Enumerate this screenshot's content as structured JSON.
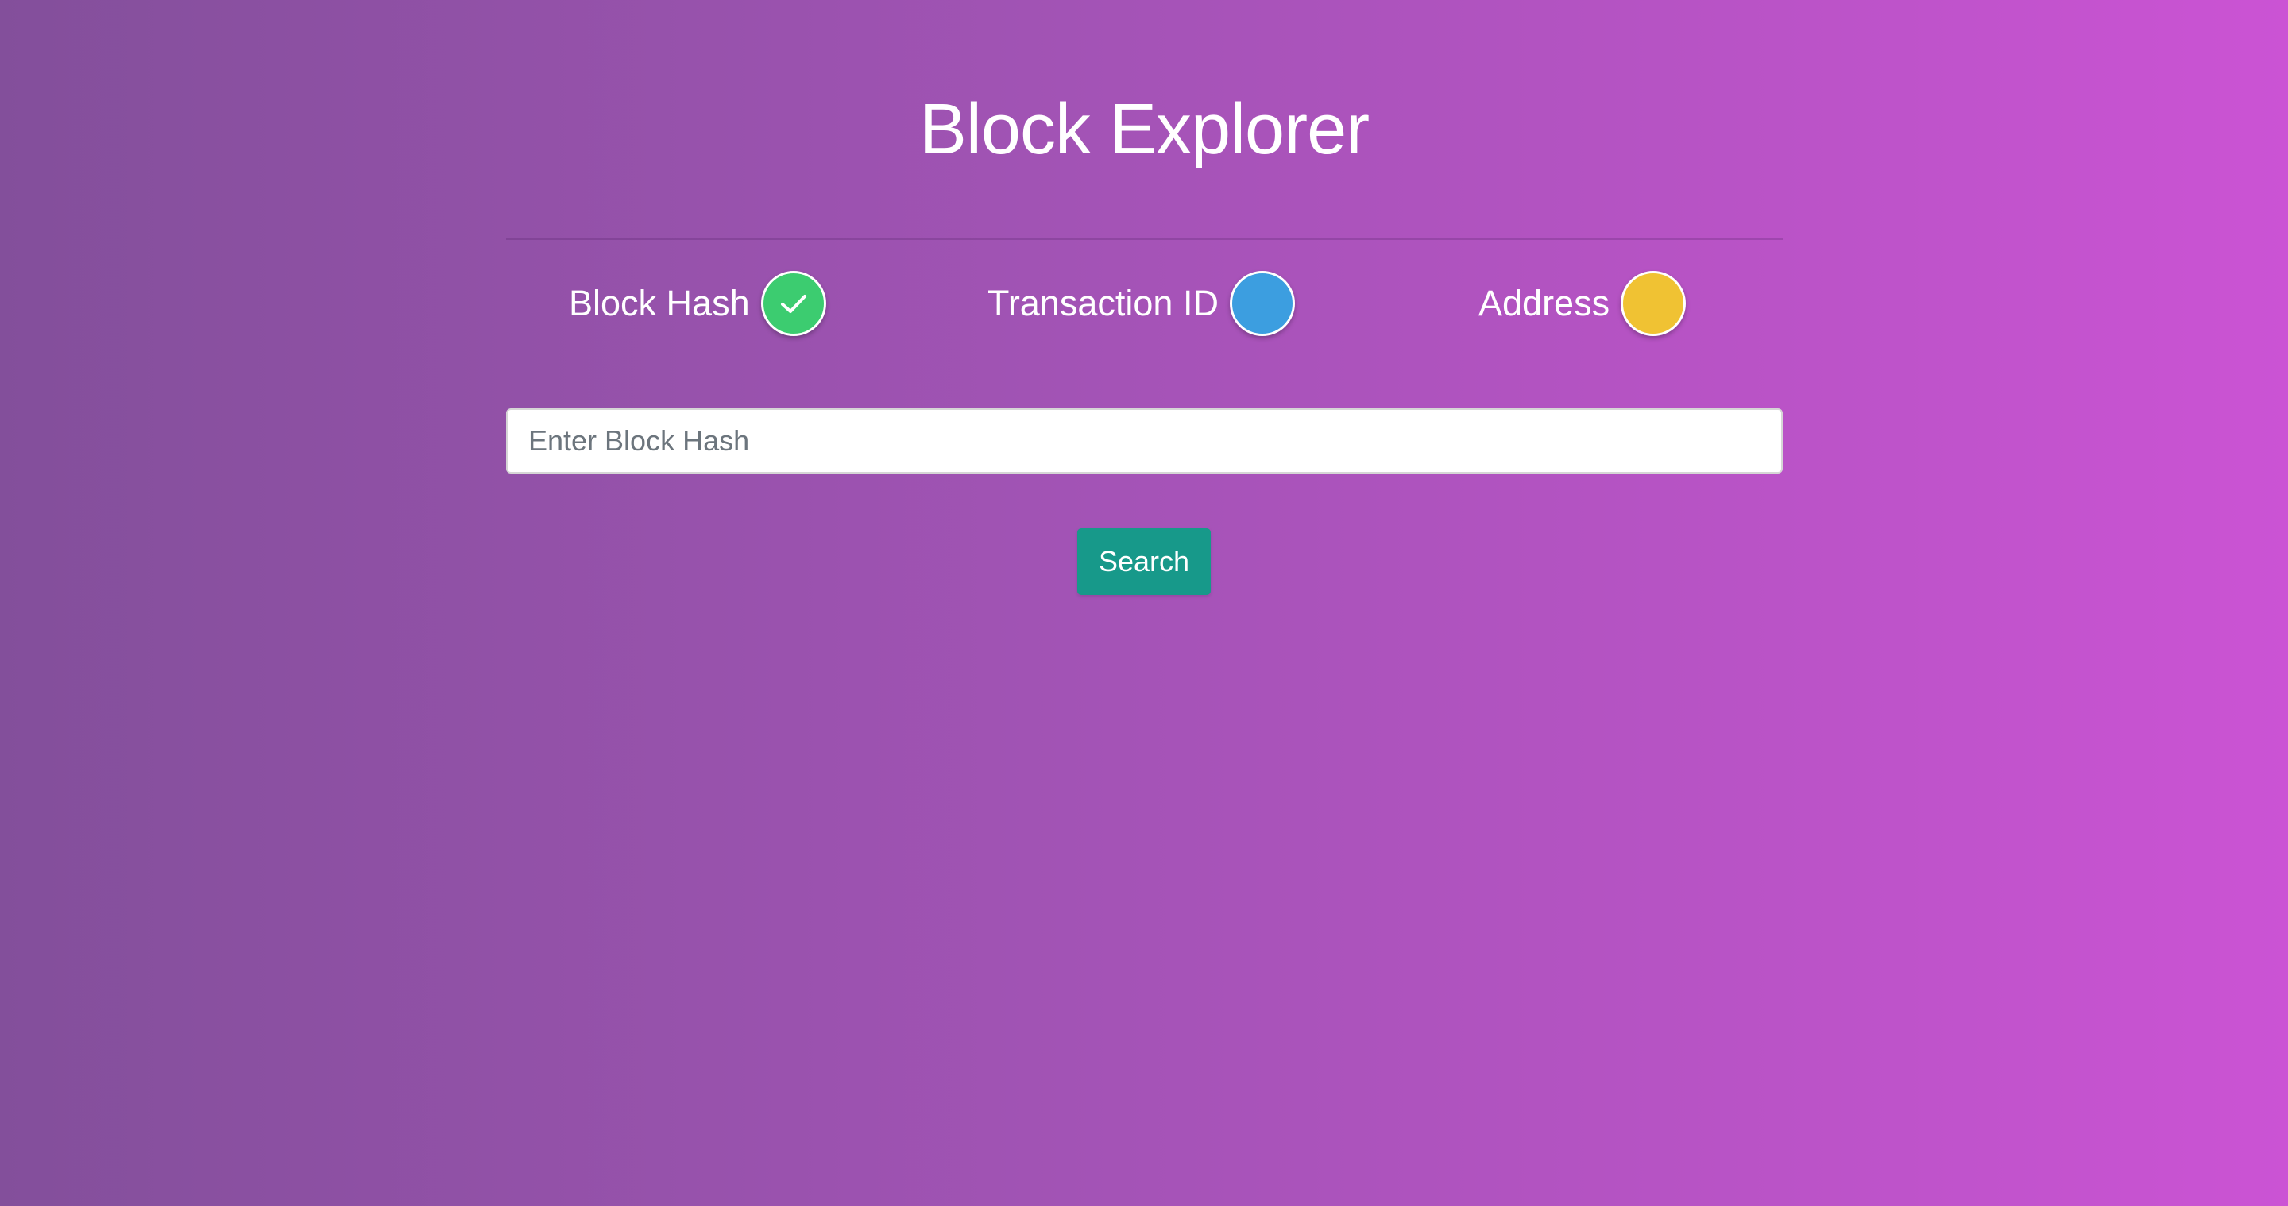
{
  "header": {
    "title": "Block Explorer"
  },
  "search_types": [
    {
      "label": "Block Hash",
      "color": "#3ccc70",
      "selected": true,
      "icon": "check-icon"
    },
    {
      "label": "Transaction ID",
      "color": "#3c9ee0",
      "selected": false
    },
    {
      "label": "Address",
      "color": "#f0c233",
      "selected": false
    }
  ],
  "search": {
    "placeholder": "Enter Block Hash",
    "value": "",
    "button_label": "Search",
    "button_color": "#17998a"
  },
  "colors": {
    "background_start": "#834f9b",
    "background_end": "#cb53d4"
  }
}
